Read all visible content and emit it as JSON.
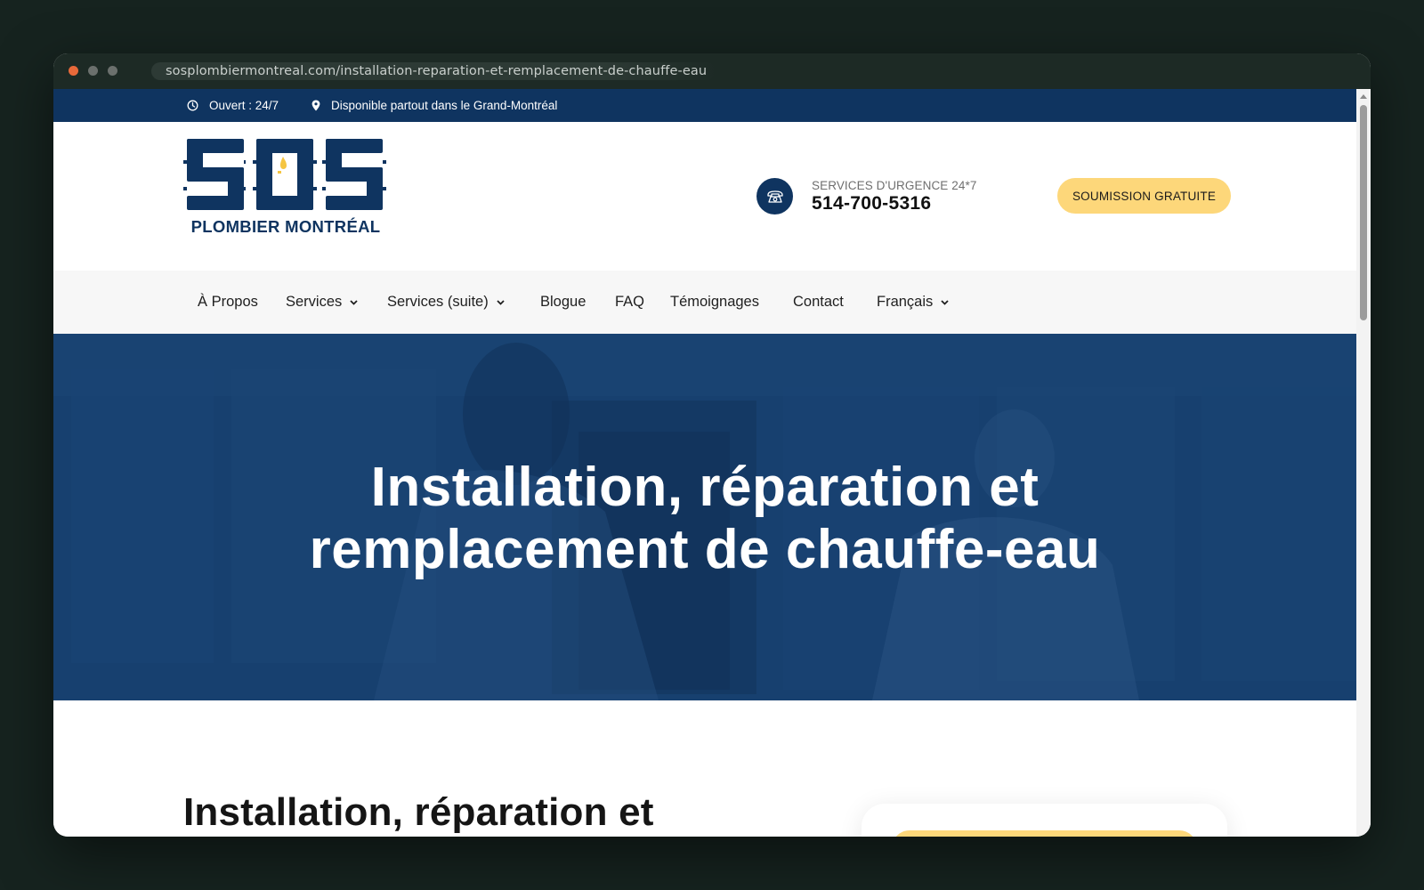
{
  "browser": {
    "url": "sosplombiermontreal.com/installation-reparation-et-remplacement-de-chauffe-eau"
  },
  "topbar": {
    "hours": "Ouvert : 24/7",
    "area": "Disponible partout dans le Grand-Montréal",
    "hours_icon": "clock-icon",
    "area_icon": "map-pin-icon"
  },
  "header": {
    "logo_text": "PLOMBIER MONTRÉAL",
    "emergency_label": "SERVICES D'URGENCE 24*7",
    "phone": "514-700-5316",
    "phone_icon": "telephone-icon",
    "cta_label": "SOUMISSION GRATUITE"
  },
  "nav": {
    "items": [
      {
        "label": "À Propos",
        "dropdown": false
      },
      {
        "label": "Services",
        "dropdown": true
      },
      {
        "label": "Services (suite)",
        "dropdown": true
      },
      {
        "label": "Blogue",
        "dropdown": false
      },
      {
        "label": "FAQ",
        "dropdown": false
      },
      {
        "label": "Témoignages",
        "dropdown": false
      },
      {
        "label": "Contact",
        "dropdown": false
      },
      {
        "label": "Français",
        "dropdown": true
      }
    ]
  },
  "hero": {
    "title_line1": "Installation, réparation et",
    "title_line2": "remplacement de chauffe-eau"
  },
  "content": {
    "title": "Installation, réparation et"
  },
  "colors": {
    "brand_navy": "#0f3460",
    "accent_yellow": "#fdd77a",
    "hero_overlay": "#17406f"
  }
}
